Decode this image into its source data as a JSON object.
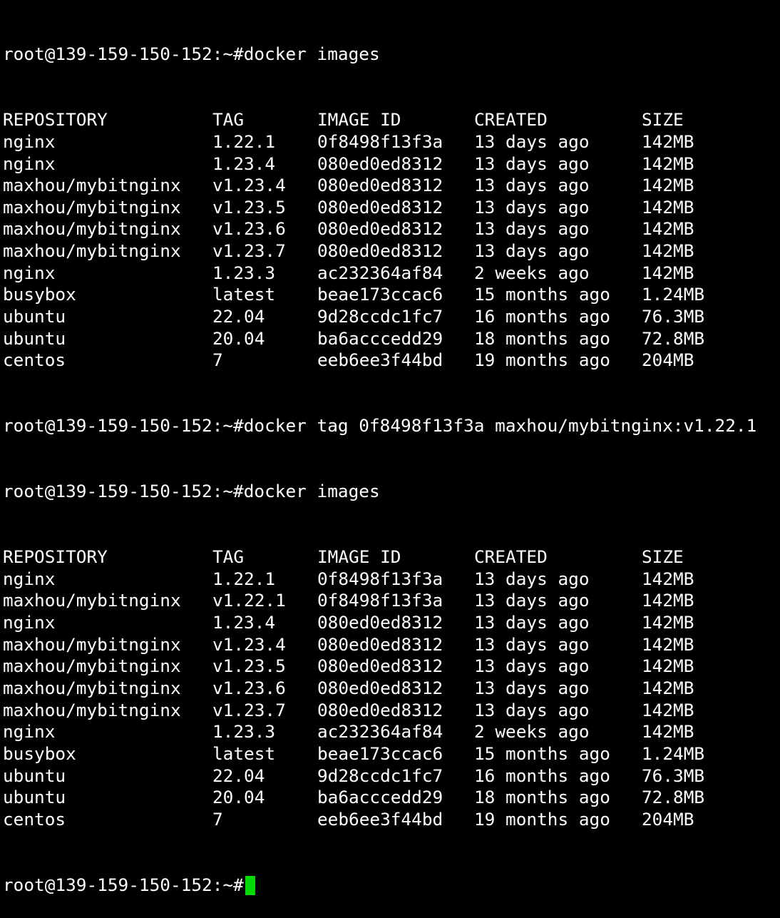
{
  "terminal": {
    "prompt": "root@139-159-150-152:~#",
    "commands": [
      "docker images",
      "docker tag 0f8498f13f3a maxhou/mybitnginx:v1.22.1",
      "docker images"
    ],
    "columns": [
      "REPOSITORY",
      "TAG",
      "IMAGE ID",
      "CREATED",
      "SIZE"
    ],
    "first_listing": [
      [
        "nginx",
        "1.22.1",
        "0f8498f13f3a",
        "13 days ago",
        "142MB"
      ],
      [
        "nginx",
        "1.23.4",
        "080ed0ed8312",
        "13 days ago",
        "142MB"
      ],
      [
        "maxhou/mybitnginx",
        "v1.23.4",
        "080ed0ed8312",
        "13 days ago",
        "142MB"
      ],
      [
        "maxhou/mybitnginx",
        "v1.23.5",
        "080ed0ed8312",
        "13 days ago",
        "142MB"
      ],
      [
        "maxhou/mybitnginx",
        "v1.23.6",
        "080ed0ed8312",
        "13 days ago",
        "142MB"
      ],
      [
        "maxhou/mybitnginx",
        "v1.23.7",
        "080ed0ed8312",
        "13 days ago",
        "142MB"
      ],
      [
        "nginx",
        "1.23.3",
        "ac232364af84",
        "2 weeks ago",
        "142MB"
      ],
      [
        "busybox",
        "latest",
        "beae173ccac6",
        "15 months ago",
        "1.24MB"
      ],
      [
        "ubuntu",
        "22.04",
        "9d28ccdc1fc7",
        "16 months ago",
        "76.3MB"
      ],
      [
        "ubuntu",
        "20.04",
        "ba6acccedd29",
        "18 months ago",
        "72.8MB"
      ],
      [
        "centos",
        "7",
        "eeb6ee3f44bd",
        "19 months ago",
        "204MB"
      ]
    ],
    "second_listing": [
      [
        "nginx",
        "1.22.1",
        "0f8498f13f3a",
        "13 days ago",
        "142MB"
      ],
      [
        "maxhou/mybitnginx",
        "v1.22.1",
        "0f8498f13f3a",
        "13 days ago",
        "142MB"
      ],
      [
        "nginx",
        "1.23.4",
        "080ed0ed8312",
        "13 days ago",
        "142MB"
      ],
      [
        "maxhou/mybitnginx",
        "v1.23.4",
        "080ed0ed8312",
        "13 days ago",
        "142MB"
      ],
      [
        "maxhou/mybitnginx",
        "v1.23.5",
        "080ed0ed8312",
        "13 days ago",
        "142MB"
      ],
      [
        "maxhou/mybitnginx",
        "v1.23.6",
        "080ed0ed8312",
        "13 days ago",
        "142MB"
      ],
      [
        "maxhou/mybitnginx",
        "v1.23.7",
        "080ed0ed8312",
        "13 days ago",
        "142MB"
      ],
      [
        "nginx",
        "1.23.3",
        "ac232364af84",
        "2 weeks ago",
        "142MB"
      ],
      [
        "busybox",
        "latest",
        "beae173ccac6",
        "15 months ago",
        "1.24MB"
      ],
      [
        "ubuntu",
        "22.04",
        "9d28ccdc1fc7",
        "16 months ago",
        "76.3MB"
      ],
      [
        "ubuntu",
        "20.04",
        "ba6acccedd29",
        "18 months ago",
        "72.8MB"
      ],
      [
        "centos",
        "7",
        "eeb6ee3f44bd",
        "19 months ago",
        "204MB"
      ]
    ],
    "colors": {
      "background": "#000000",
      "text": "#ffffff",
      "cursor": "#00d800"
    },
    "cursor_icon": "block-cursor"
  }
}
